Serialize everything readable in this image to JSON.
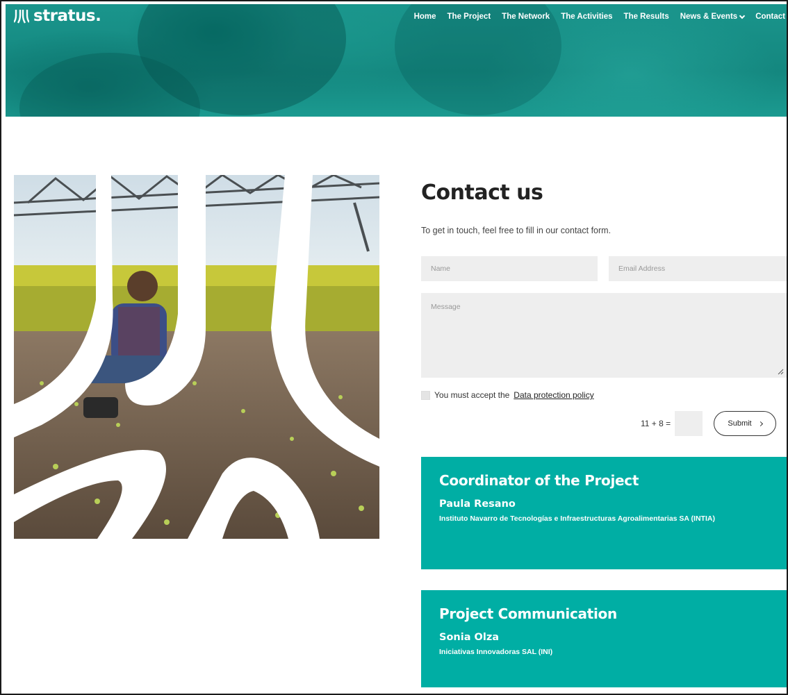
{
  "brand": {
    "name": "stratus."
  },
  "nav": {
    "items": [
      {
        "label": "Home"
      },
      {
        "label": "The Project"
      },
      {
        "label": "The Network"
      },
      {
        "label": "The Activities"
      },
      {
        "label": "The Results"
      },
      {
        "label": "News & Events",
        "dropdown": true
      },
      {
        "label": "Contact"
      }
    ]
  },
  "contact": {
    "title": "Contact us",
    "intro": "To get in touch, feel free to fill in our contact form.",
    "name_placeholder": "Name",
    "email_placeholder": "Email Address",
    "message_placeholder": "Message",
    "consent_prefix": "You must accept the",
    "consent_link": "Data protection policy",
    "captcha": "11 + 8 =",
    "submit_label": "Submit"
  },
  "cards": {
    "coordinator": {
      "heading": "Coordinator of the Project",
      "person": "Paula Resano",
      "org": "Instituto Navarro de Tecnologías e Infraestructuras Agroalimentarias SA (INTIA)"
    },
    "communication": {
      "heading": "Project Communication",
      "person": "Sonia Olza",
      "org": "Iniciativas Innovadoras SAL (INI)"
    }
  },
  "colors": {
    "accent": "#00aea4",
    "hero": "#14877f",
    "input_bg": "#eeeeee"
  },
  "icons": [
    "stratus-logo-icon",
    "chevron-down-icon",
    "chevron-right-icon",
    "resize-handle-icon"
  ]
}
